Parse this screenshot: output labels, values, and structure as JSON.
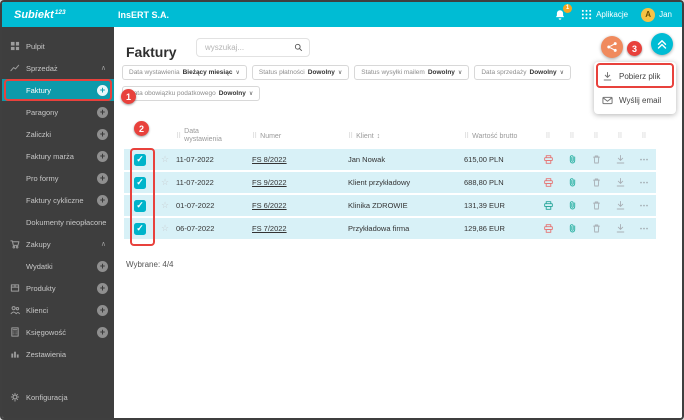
{
  "icons": {
    "chevron_up": "∧",
    "chevron_down": "∨",
    "plus": "+",
    "grip": "⠿",
    "star": "☆",
    "check": "✓",
    "sort": "↕",
    "more": "⋯"
  },
  "topbar": {
    "brand": "Subiekt",
    "brand_sup": "123",
    "company": "InsERT S.A.",
    "notification_count": "1",
    "apps_label": "Aplikacje",
    "user_initial": "A",
    "user_name": "Jan"
  },
  "sidebar": {
    "items": [
      {
        "label": "Pulpit"
      },
      {
        "label": "Sprzedaż"
      },
      {
        "label": "Faktury"
      },
      {
        "label": "Paragony"
      },
      {
        "label": "Zaliczki"
      },
      {
        "label": "Faktury marża"
      },
      {
        "label": "Pro formy"
      },
      {
        "label": "Faktury cykliczne"
      },
      {
        "label": "Dokumenty nieopłacone"
      },
      {
        "label": "Zakupy"
      },
      {
        "label": "Wydatki"
      },
      {
        "label": "Produkty"
      },
      {
        "label": "Klienci"
      },
      {
        "label": "Księgowość"
      },
      {
        "label": "Zestawienia"
      },
      {
        "label": "Konfiguracja"
      }
    ]
  },
  "main": {
    "title": "Faktury",
    "search_placeholder": "wyszukaj...",
    "filters": [
      {
        "label": "Data wystawienia",
        "value": "Bieżący miesiąc"
      },
      {
        "label": "Status płatności",
        "value": "Dowolny"
      },
      {
        "label": "Status wysyłki mailem",
        "value": "Dowolny"
      },
      {
        "label": "Data sprzedaży",
        "value": "Dowolny"
      },
      {
        "label": "Data obowiązku podatkowego",
        "value": "Dowolny"
      }
    ],
    "menu": {
      "items": [
        {
          "label": "Pobierz plik"
        },
        {
          "label": "Wyślij email"
        }
      ]
    },
    "table": {
      "headers": {
        "date": "Data wystawienia",
        "number": "Numer",
        "client": "Klient",
        "gross": "Wartość brutto"
      },
      "rows": [
        {
          "date": "11-07-2022",
          "number": "FS 8/2022",
          "client": "Jan Nowak",
          "gross": "615,00 PLN",
          "status_color": "#e57373"
        },
        {
          "date": "11-07-2022",
          "number": "FS 9/2022",
          "client": "Klient przykładowy",
          "gross": "688,80 PLN",
          "status_color": "#e57373"
        },
        {
          "date": "01-07-2022",
          "number": "FS 6/2022",
          "client": "Klinika ZDROWIE",
          "gross": "131,39 EUR",
          "status_color": "#26a69a"
        },
        {
          "date": "06-07-2022",
          "number": "FS 7/2022",
          "client": "Przykładowa firma",
          "gross": "129,86 EUR",
          "status_color": "#e57373"
        }
      ]
    },
    "selected_summary": "Wybrane: 4/4"
  },
  "annotations": {
    "step1": "1",
    "step2": "2",
    "step3": "3",
    "color": "#e8413c"
  },
  "colors": {
    "topbar": "#00bcd4",
    "sidebar": "#3e3e3e",
    "selected_item": "#0d9aaa",
    "row_highlight": "#d8f1f7",
    "accent_orange": "#f08a5d",
    "accent_teal": "#00bcd4",
    "avatar": "#f6c344"
  }
}
